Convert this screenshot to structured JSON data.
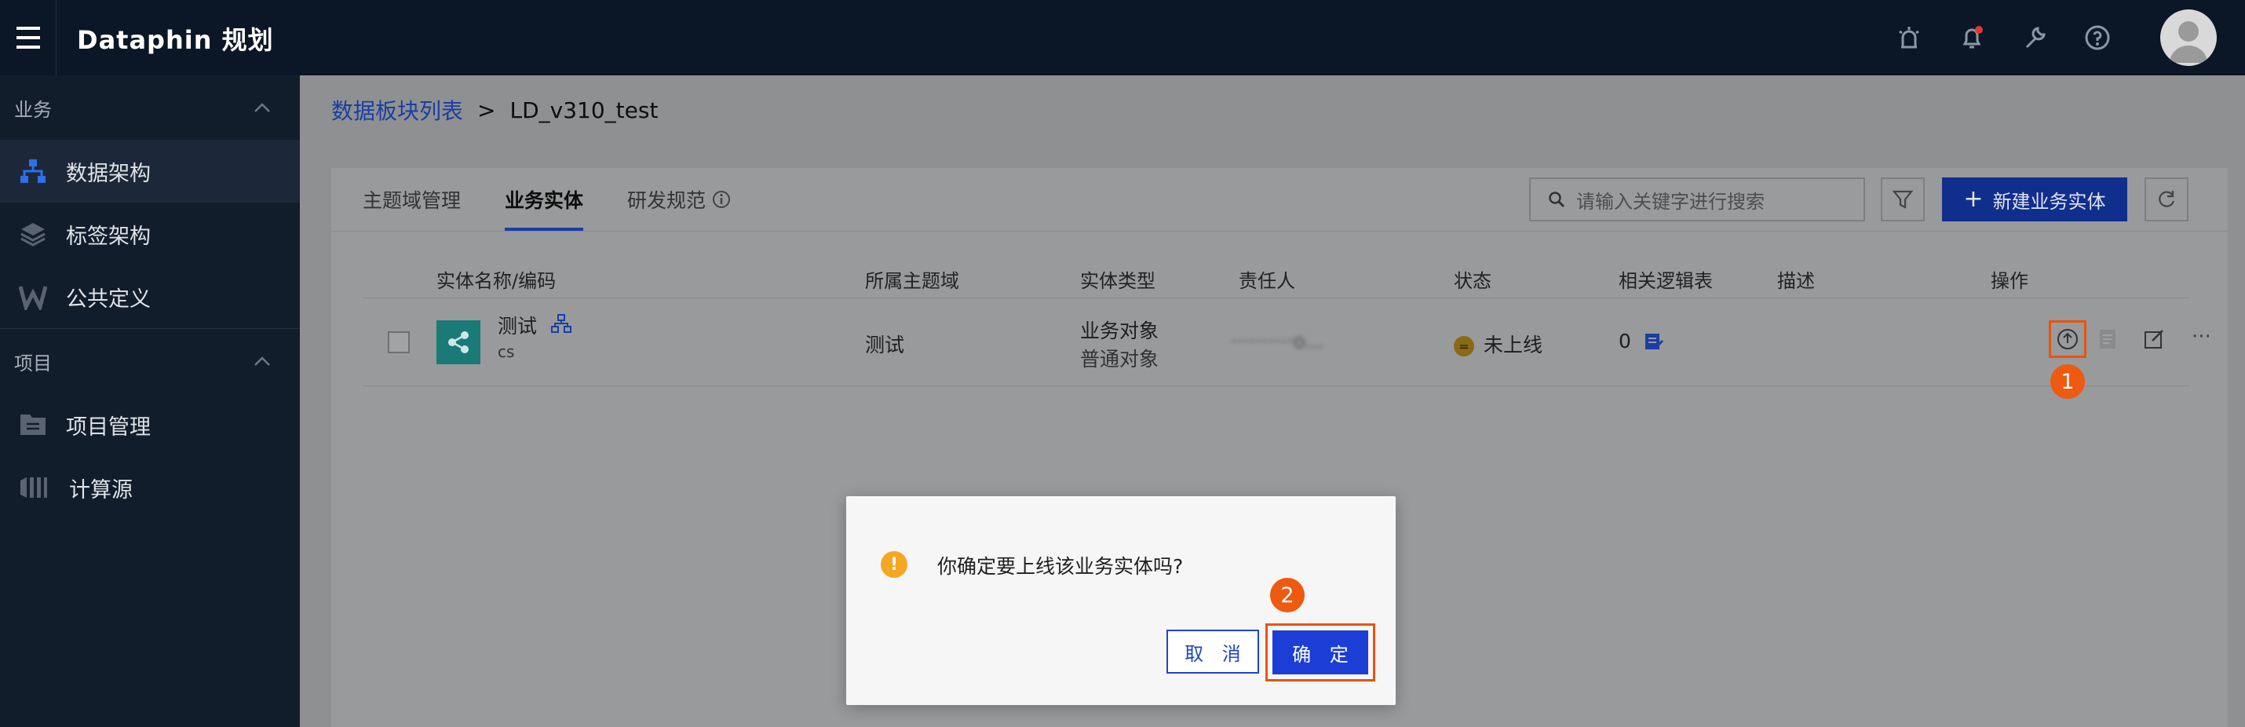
{
  "app": {
    "title": "Dataphin 规划"
  },
  "sidebar": {
    "sections": [
      {
        "label": "业务",
        "items": [
          {
            "label": "数据架构",
            "icon": "hierarchy-icon",
            "active": true
          },
          {
            "label": "标签架构",
            "icon": "layers-icon",
            "active": false
          },
          {
            "label": "公共定义",
            "icon": "w-letter-icon",
            "active": false
          }
        ]
      },
      {
        "label": "项目",
        "items": [
          {
            "label": "项目管理",
            "icon": "project-icon",
            "active": false
          },
          {
            "label": "计算源",
            "icon": "compute-source-icon",
            "active": false
          }
        ]
      }
    ]
  },
  "breadcrumb": {
    "parent": "数据板块列表",
    "separator": ">",
    "current": "LD_v310_test"
  },
  "tabs": [
    {
      "label": "主题域管理",
      "active": false
    },
    {
      "label": "业务实体",
      "active": true
    },
    {
      "label": "研发规范",
      "active": false
    }
  ],
  "search": {
    "placeholder": "请输入关键字进行搜索"
  },
  "toolbar": {
    "new_label": "新建业务实体"
  },
  "table": {
    "columns": [
      "实体名称/编码",
      "所属主题域",
      "实体类型",
      "责任人",
      "状态",
      "相关逻辑表",
      "描述",
      "操作"
    ],
    "rows": [
      {
        "name": "测试",
        "code": "cs",
        "domain": "测试",
        "type": "业务对象",
        "subtype": "普通对象",
        "owner": "··········o...",
        "status": "未上线",
        "logic_tables": "0",
        "description": ""
      }
    ]
  },
  "annotations": {
    "step1": "1",
    "step2": "2"
  },
  "dialog": {
    "message": "你确定要上线该业务实体吗?",
    "cancel": "取 消",
    "ok": "确 定"
  },
  "colors": {
    "primary": "#1c3ed6",
    "highlight": "#e8540e",
    "warning": "#f5a623",
    "topbar": "#0b1626"
  }
}
